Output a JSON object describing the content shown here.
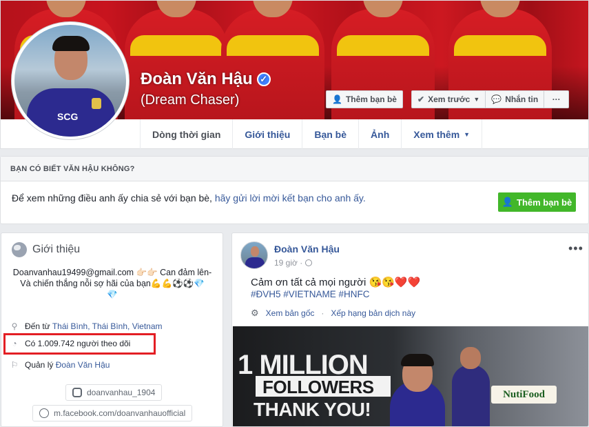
{
  "profile": {
    "name": "Đoàn Văn Hậu",
    "nickname": "(Dream Chaser)",
    "avatar_logo": "SCG"
  },
  "cover_actions": {
    "add_friend": "Thêm bạn bè",
    "follow": "Xem trước",
    "message": "Nhắn tin",
    "more": "···"
  },
  "tabs": [
    {
      "label": "Dòng thời gian"
    },
    {
      "label": "Giới thiệu"
    },
    {
      "label": "Bạn bè"
    },
    {
      "label": "Ảnh"
    },
    {
      "label": "Xem thêm"
    }
  ],
  "know": {
    "title": "BẠN CÓ BIẾT VĂN HẬU KHÔNG?",
    "body_text": "Để xem những điều anh ấy chia sẻ với bạn bè, ",
    "body_link": "hãy gửi lời mời kết bạn cho anh ấy.",
    "add_button": "Thêm bạn bè"
  },
  "intro": {
    "title": "Giới thiệu",
    "bio_line1": "Doanvanhau19499@gmail.com 👉🏻👉🏻 Can đảm lên-",
    "bio_line2": "Và chiến thắng nỗi sợ hãi của bạn💪💪⚽⚽💎",
    "bio_line3": "💎",
    "from_prefix": "Đến từ",
    "from_value": "Thái Bình, Thái Bình, Vietnam",
    "followers_text": "Có 1.009.742 người theo dõi",
    "managed_prefix": "Quản lý",
    "managed_value": "Đoàn Văn Hậu",
    "instagram": "doanvanhau_1904",
    "website": "m.facebook.com/doanvanhauofficial"
  },
  "post": {
    "author": "Đoàn Văn Hậu",
    "time": "19 giờ ·",
    "text": "Cảm ơn tất cả mọi người",
    "emoji_faces": "😘😘",
    "emoji_hearts": "❤️❤️",
    "hashtags": "#ĐVH5 #VIETNAME #HNFC",
    "see_original": "Xem bản gốc",
    "rate_translation": "Xếp hạng bản dịch này",
    "more": "•••",
    "image_line1": "1 MILLION",
    "image_line2": "FOLLOWERS",
    "image_line3": "THANK YOU!",
    "image_sponsor": "NutiFood"
  },
  "colors": {
    "link": "#365899",
    "green": "#42b72a",
    "highlight": "#e31e24",
    "verified": "#4080ff"
  }
}
